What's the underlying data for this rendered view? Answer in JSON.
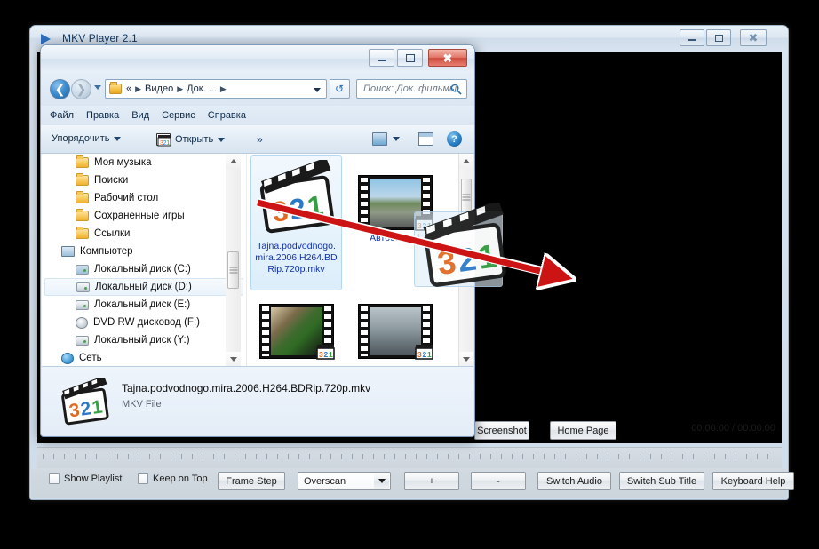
{
  "player": {
    "title": "MKV Player 2.1",
    "logo_icon": "play-triangle-icon",
    "window_buttons": {
      "minimize": "minimize-icon",
      "maximize": "maximize-icon",
      "close": "close-icon"
    },
    "time_display": "00:00:00 / 00:00:00",
    "upper_buttons": [
      {
        "name": "screenshot",
        "label": "Screenshot"
      },
      {
        "name": "home-page",
        "label": "Home Page"
      }
    ],
    "checkboxes": [
      {
        "name": "show-playlist",
        "label": "Show Playlist",
        "checked": false
      },
      {
        "name": "keep-on-top",
        "label": "Keep on Top",
        "checked": false
      }
    ],
    "buttons": [
      {
        "name": "frame-step",
        "label": "Frame Step"
      },
      {
        "name": "zoom-in",
        "label": "+"
      },
      {
        "name": "zoom-out",
        "label": "-"
      },
      {
        "name": "switch-audio",
        "label": "Switch Audio"
      },
      {
        "name": "switch-sub-title",
        "label": "Switch Sub Title"
      },
      {
        "name": "keyboard-help",
        "label": "Keyboard Help"
      }
    ],
    "overscan_select": {
      "label": "Overscan",
      "options": [
        "Overscan"
      ]
    }
  },
  "explorer": {
    "window_buttons": {
      "minimize": "minimize-icon",
      "maximize": "maximize-icon",
      "close": "close-icon"
    },
    "nav": {
      "back_icon": "back-arrow-icon",
      "forward_icon": "forward-arrow-icon",
      "history_icon": "chevron-down-icon",
      "refresh_icon": "refresh-icon",
      "folder_icon": "folder-icon",
      "breadcrumbs": [
        "«",
        "Видео",
        "Док. ..."
      ],
      "dropdown_icon": "chevron-down-icon"
    },
    "search": {
      "placeholder": "Поиск: Док. фильмы",
      "icon": "search-icon",
      "value": ""
    },
    "menu": [
      "Файл",
      "Правка",
      "Вид",
      "Сервис",
      "Справка"
    ],
    "toolbar": {
      "organize": "Упорядочить",
      "open": "Открыть",
      "more": "»",
      "preview_icon": "preview-pane-icon",
      "layout_icon": "layout-pane-icon",
      "help_icon": "help-icon",
      "help_label": "?"
    },
    "tree": [
      {
        "label": "Моя музыка",
        "icon": "folder-icon",
        "level": 1,
        "selected": false
      },
      {
        "label": "Поиски",
        "icon": "folder-icon",
        "level": 1,
        "selected": false
      },
      {
        "label": "Рабочий стол",
        "icon": "folder-icon",
        "level": 1,
        "selected": false
      },
      {
        "label": "Сохраненные игры",
        "icon": "folder-icon",
        "level": 1,
        "selected": false
      },
      {
        "label": "Ссылки",
        "icon": "folder-icon",
        "level": 1,
        "selected": false
      },
      {
        "label": "Компьютер",
        "icon": "computer-icon",
        "level": 0,
        "selected": false
      },
      {
        "label": "Локальный диск (C:)",
        "icon": "system-drive-icon",
        "level": 1,
        "selected": false
      },
      {
        "label": "Локальный диск (D:)",
        "icon": "drive-icon",
        "level": 1,
        "selected": true
      },
      {
        "label": "Локальный диск (E:)",
        "icon": "drive-icon",
        "level": 1,
        "selected": false
      },
      {
        "label": "DVD RW дисковод (F:)",
        "icon": "dvd-drive-icon",
        "level": 1,
        "selected": false
      },
      {
        "label": "Локальный диск (Y:)",
        "icon": "drive-icon",
        "level": 1,
        "selected": false
      },
      {
        "label": "Сеть",
        "icon": "network-icon",
        "level": 0,
        "selected": false
      }
    ],
    "files": [
      {
        "label": "Tajna.podvodnogo.mira.2006.H264.BDRip.720p.mkv",
        "icon": "mkv-clapboard-icon",
        "selected": true
      },
      {
        "label": "Автобан.avi",
        "icon": "video-thumbnail-icon",
        "selected": false
      },
      {
        "label": "",
        "icon": "video-thumbnail-icon",
        "selected": false
      },
      {
        "label": "",
        "icon": "video-thumbnail-icon",
        "selected": false
      }
    ],
    "details": {
      "filename": "Tajna.podvodnogo.mira.2006.H264.BDRip.720p.mkv",
      "filetype": "MKV File",
      "icon": "mkv-clapboard-icon"
    },
    "scrollbar": {
      "up_icon": "scroll-up-arrow-icon",
      "down_icon": "scroll-down-arrow-icon"
    }
  },
  "annotation": {
    "arrow_color": "#cc1414",
    "arrow_name": "drag-direction-arrow",
    "drag_ghost_label": "mkv-file-drag-ghost"
  }
}
